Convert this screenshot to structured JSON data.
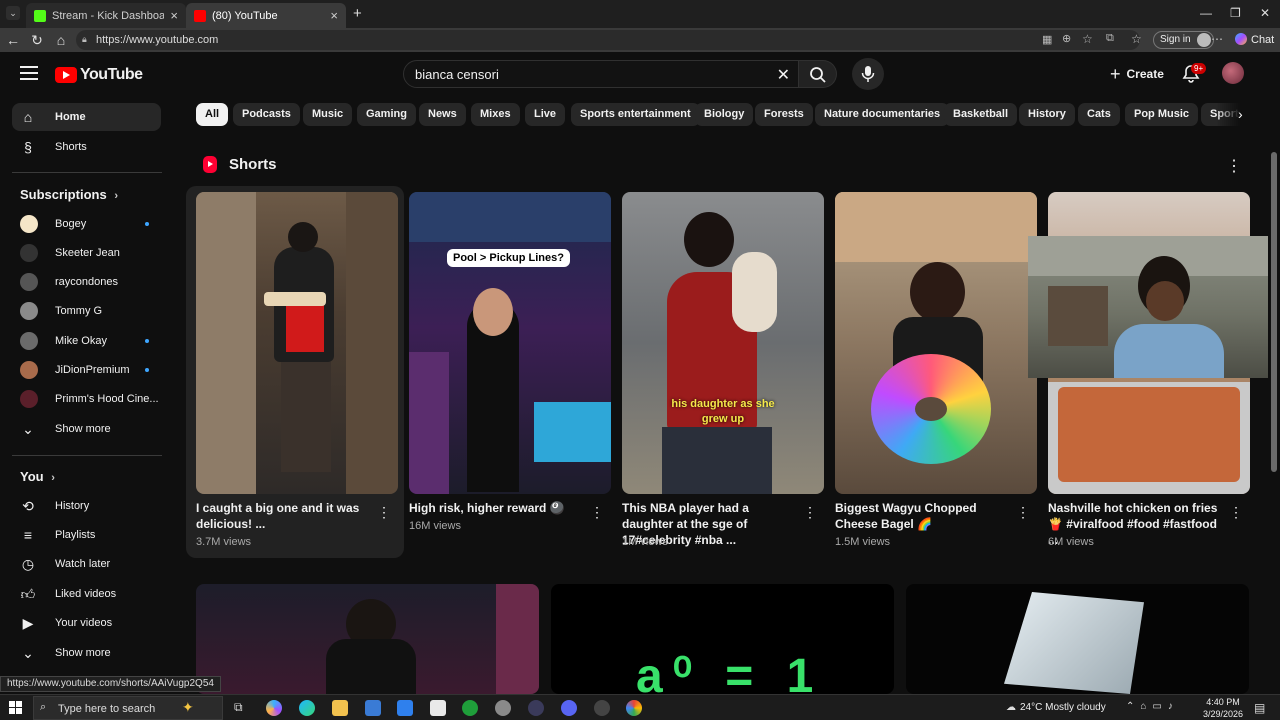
{
  "browser": {
    "tabs": [
      {
        "title": "Stream - Kick Dashboard",
        "favicon_color": "#53fc18"
      },
      {
        "title": "(80) YouTube",
        "favicon_color": "#ff0000"
      }
    ],
    "url": "https://www.youtube.com",
    "signin_label": "Sign in",
    "chat_label": "Chat"
  },
  "header": {
    "logo_text": "YouTube",
    "search_value": "bianca censori",
    "create_label": "Create",
    "notification_count": "9+"
  },
  "sidebar": {
    "main": [
      {
        "label": "Home",
        "icon": "home-icon",
        "active": true
      },
      {
        "label": "Shorts",
        "icon": "shorts-icon"
      }
    ],
    "subscriptions_heading": "Subscriptions",
    "subscriptions": [
      {
        "label": "Bogey",
        "color": "#f5e6c8",
        "live": true
      },
      {
        "label": "Skeeter Jean",
        "color": "#333333",
        "live": false
      },
      {
        "label": "raycondones",
        "color": "#555555",
        "live": false
      },
      {
        "label": "Tommy G",
        "color": "#8a8a8a",
        "live": false
      },
      {
        "label": "Mike Okay",
        "color": "#6b6b6b",
        "live": true
      },
      {
        "label": "JiDionPremium",
        "color": "#a86b4b",
        "live": true
      },
      {
        "label": "Primm's Hood Cine...",
        "color": "#5a1f2a",
        "live": false
      }
    ],
    "show_more_label": "Show more",
    "you_heading": "You",
    "you_items": [
      {
        "label": "History",
        "icon": "history-icon"
      },
      {
        "label": "Playlists",
        "icon": "playlists-icon"
      },
      {
        "label": "Watch later",
        "icon": "watch-later-icon"
      },
      {
        "label": "Liked videos",
        "icon": "liked-videos-icon"
      },
      {
        "label": "Your videos",
        "icon": "your-videos-icon"
      }
    ],
    "show_more_label_2": "Show more"
  },
  "chips": [
    "All",
    "Podcasts",
    "Music",
    "Gaming",
    "News",
    "Mixes",
    "Live",
    "Sports entertainment",
    "Biology",
    "Forests",
    "Nature documentaries",
    "Basketball",
    "History",
    "Cats",
    "Pop Music",
    "Sport"
  ],
  "shorts": {
    "heading": "Shorts",
    "items": [
      {
        "title": "I caught a big one and it was delicious! ...",
        "views": "3.7M views"
      },
      {
        "title": "High risk, higher reward 🎱",
        "views": "16M views",
        "overlay": "Pool > Pickup Lines?"
      },
      {
        "title": "This NBA player had a daughter at the sge of 17#celebrity #nba ...",
        "views": "1M views",
        "overlay": "his daughter as she grew up"
      },
      {
        "title": "Biggest Wagyu Chopped Cheese Bagel 🌈",
        "views": "1.5M views"
      },
      {
        "title": "Nashville hot chicken on fries 🍟 #viralfood #food #fastfood ...",
        "views": "6M views"
      }
    ]
  },
  "row2": {
    "math_text": "a⁰ = 1"
  },
  "status_url": "https://www.youtube.com/shorts/AAiVugp2Q54",
  "taskbar": {
    "search_placeholder": "Type here to search",
    "weather": "24°C  Mostly cloudy",
    "time": "4:40 PM",
    "date": "3/29/2026"
  }
}
